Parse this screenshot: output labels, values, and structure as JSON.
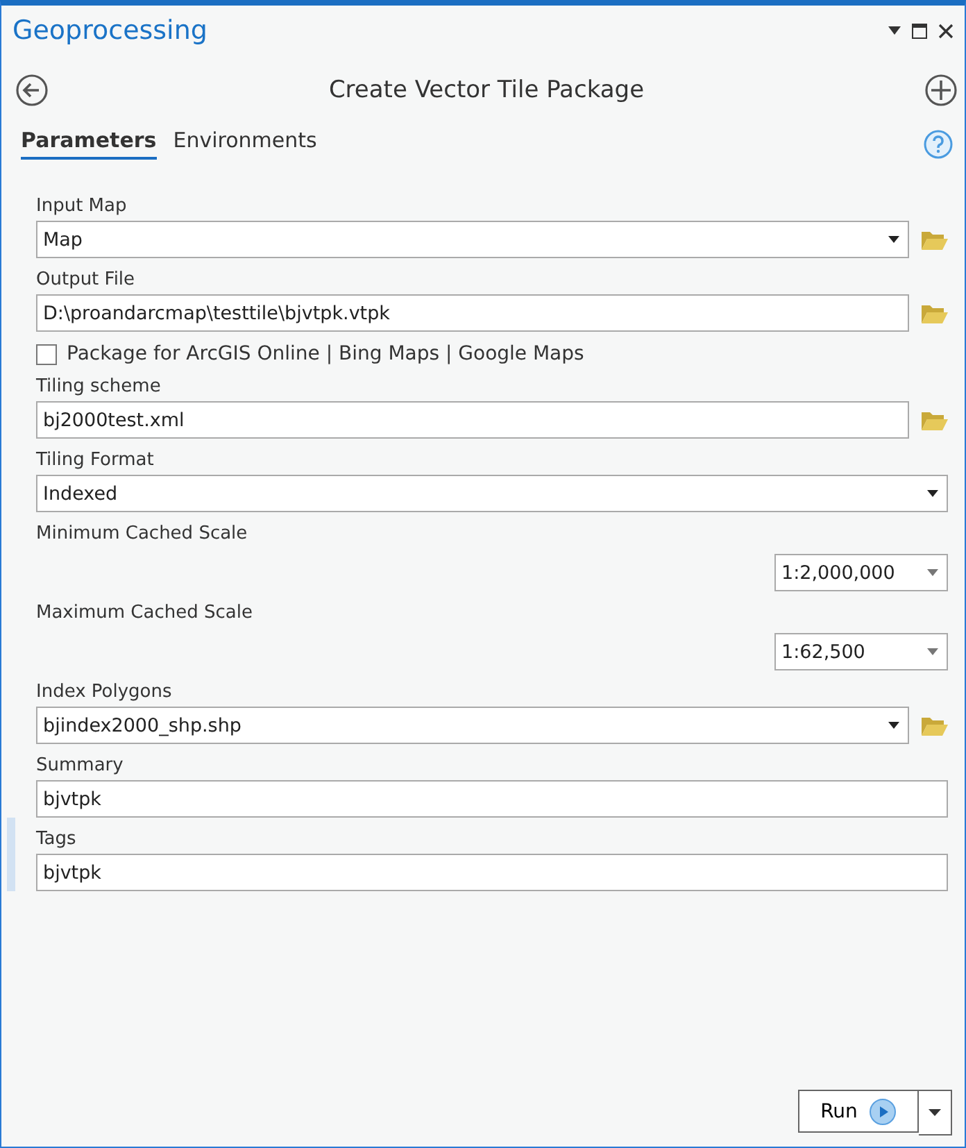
{
  "window": {
    "title": "Geoprocessing"
  },
  "tool": {
    "title": "Create Vector Tile Package"
  },
  "tabs": [
    {
      "label": "Parameters",
      "selected": true
    },
    {
      "label": "Environments",
      "selected": false
    }
  ],
  "parameters": [
    {
      "kind": "combo",
      "label": "Input Map",
      "value": "Map",
      "active": false
    },
    {
      "kind": "file",
      "label": "Output File",
      "value": "D:\\proandarcmap\\testtile\\bjvtpk.vtpk",
      "active": false
    },
    {
      "kind": "checkbox",
      "label": "Package for ArcGIS Online | Bing Maps | Google Maps",
      "checked": false,
      "active": false
    },
    {
      "kind": "file",
      "label": "Tiling scheme",
      "value": "bj2000test.xml",
      "active": false
    },
    {
      "kind": "dropdown",
      "label": "Tiling Format",
      "value": "Indexed",
      "active": false
    },
    {
      "kind": "scale",
      "label": "Minimum Cached Scale",
      "value": "1:2,000,000",
      "active": false
    },
    {
      "kind": "scale",
      "label": "Maximum Cached Scale",
      "value": "1:62,500",
      "active": false
    },
    {
      "kind": "combo",
      "label": "Index Polygons",
      "value": "bjindex2000_shp.shp",
      "active": false
    },
    {
      "kind": "text",
      "label": "Summary",
      "value": "bjvtpk",
      "active": false
    },
    {
      "kind": "text",
      "label": "Tags",
      "value": "bjvtpk",
      "active": true
    }
  ],
  "run_button": {
    "label": "Run"
  }
}
